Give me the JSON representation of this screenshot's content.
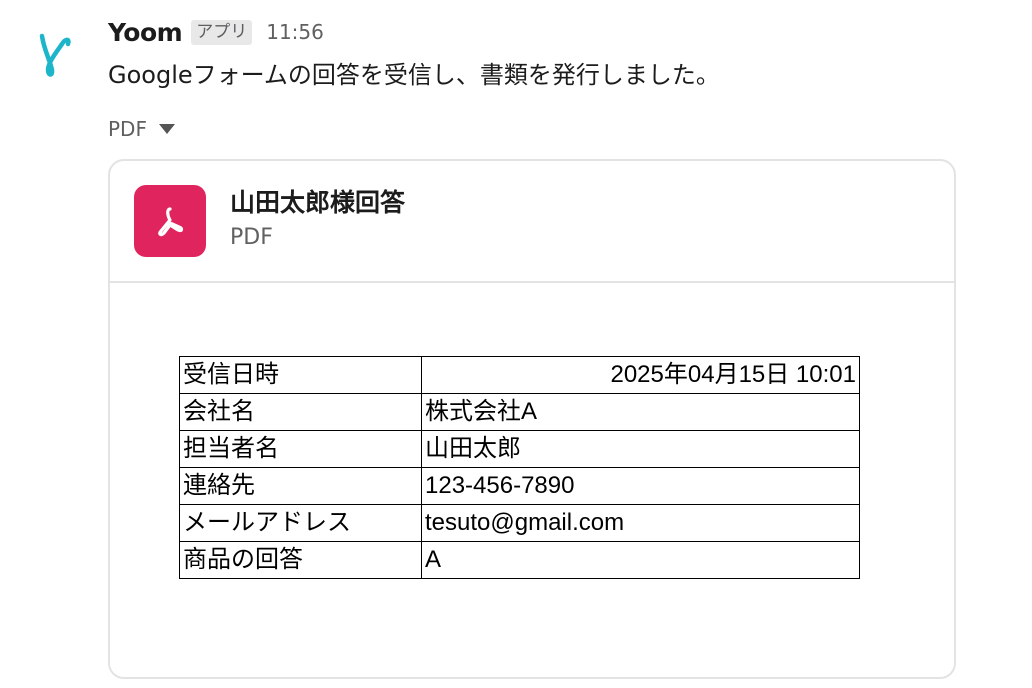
{
  "message": {
    "sender": "Yoom",
    "badge": "アプリ",
    "time": "11:56",
    "text": "Googleフォームの回答を受信し、書類を発行しました。",
    "accent_color": "#1cb5c9"
  },
  "attachment": {
    "toggle_label": "PDF",
    "title": "山田太郎様回答",
    "type_label": "PDF",
    "icon": "pdf-icon",
    "icon_color": "#e0245e"
  },
  "form_table": {
    "rows": [
      {
        "label": "受信日時",
        "value": "2025年04月15日 10:01"
      },
      {
        "label": "会社名",
        "value": "株式会社A"
      },
      {
        "label": "担当者名",
        "value": "山田太郎"
      },
      {
        "label": "連絡先",
        "value": "123-456-7890"
      },
      {
        "label": "メールアドレス",
        "value": "tesuto@gmail.com"
      },
      {
        "label": "商品の回答",
        "value": "A"
      }
    ]
  }
}
